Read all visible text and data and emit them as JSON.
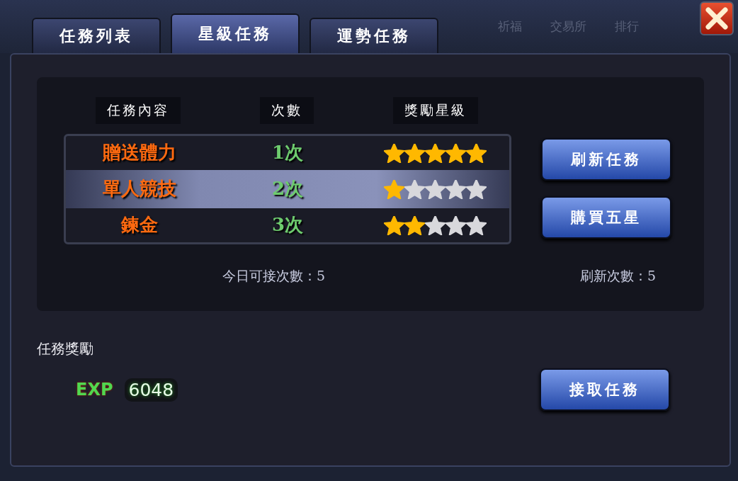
{
  "background_labels": [
    "祈福",
    "交易所",
    "排行"
  ],
  "tabs": [
    {
      "label": "任務列表",
      "selected": false
    },
    {
      "label": "星級任務",
      "selected": true
    },
    {
      "label": "運勢任務",
      "selected": false
    }
  ],
  "columns": [
    "任務內容",
    "次數",
    "獎勵星級"
  ],
  "quests": [
    {
      "name": "贈送體力",
      "count": "1次",
      "stars": 5,
      "selected": false
    },
    {
      "name": "單人競技",
      "count": "2次",
      "stars": 1,
      "selected": true
    },
    {
      "name": "鍊金",
      "count": "3次",
      "stars": 2,
      "selected": false
    }
  ],
  "buttons": [
    "刷新任務",
    "購買五星"
  ],
  "daily_accept": "今日可接次數：5",
  "refresh_count": "刷新次數：5",
  "reward": {
    "title": "任務獎勵",
    "label": "EXP",
    "value": "6048"
  },
  "accept_button": "接取任務"
}
